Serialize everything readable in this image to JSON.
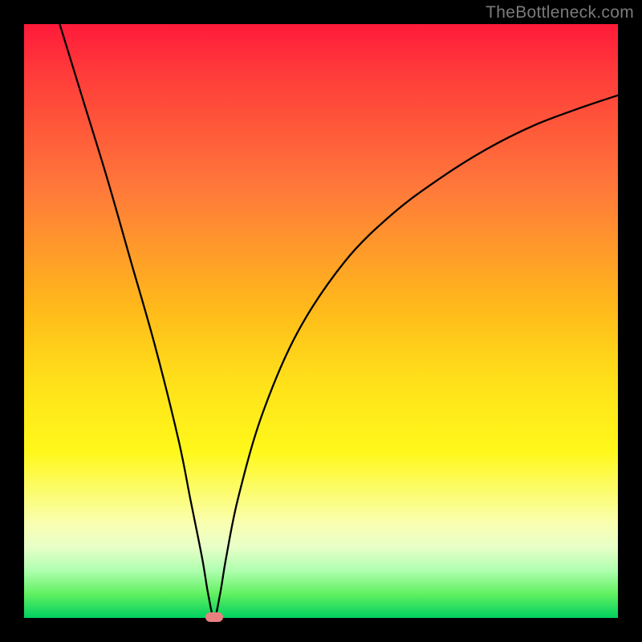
{
  "attribution": "TheBottleneck.com",
  "colors": {
    "background": "#000000",
    "gradient_top": "#ff1a3a",
    "gradient_bottom": "#00d060",
    "curve": "#000000",
    "marker": "#e98080",
    "attribution_text": "#7a7a7a"
  },
  "chart_data": {
    "type": "line",
    "title": "",
    "xlabel": "",
    "ylabel": "",
    "xlim": [
      0,
      100
    ],
    "ylim": [
      0,
      100
    ],
    "grid": false,
    "legend": false,
    "series": [
      {
        "name": "bottleneck-curve",
        "x": [
          6,
          10,
          14,
          18,
          22,
          26,
          28,
          30,
          31,
          32,
          33,
          34,
          36,
          40,
          46,
          54,
          62,
          70,
          78,
          86,
          94,
          100
        ],
        "y": [
          100,
          87,
          74,
          60,
          46,
          30,
          20,
          10,
          4,
          0,
          4,
          10,
          20,
          34,
          48,
          60,
          68,
          74,
          79,
          83,
          86,
          88
        ]
      }
    ],
    "annotations": [
      {
        "name": "minimum-marker",
        "x": 32,
        "y": 0
      }
    ]
  }
}
